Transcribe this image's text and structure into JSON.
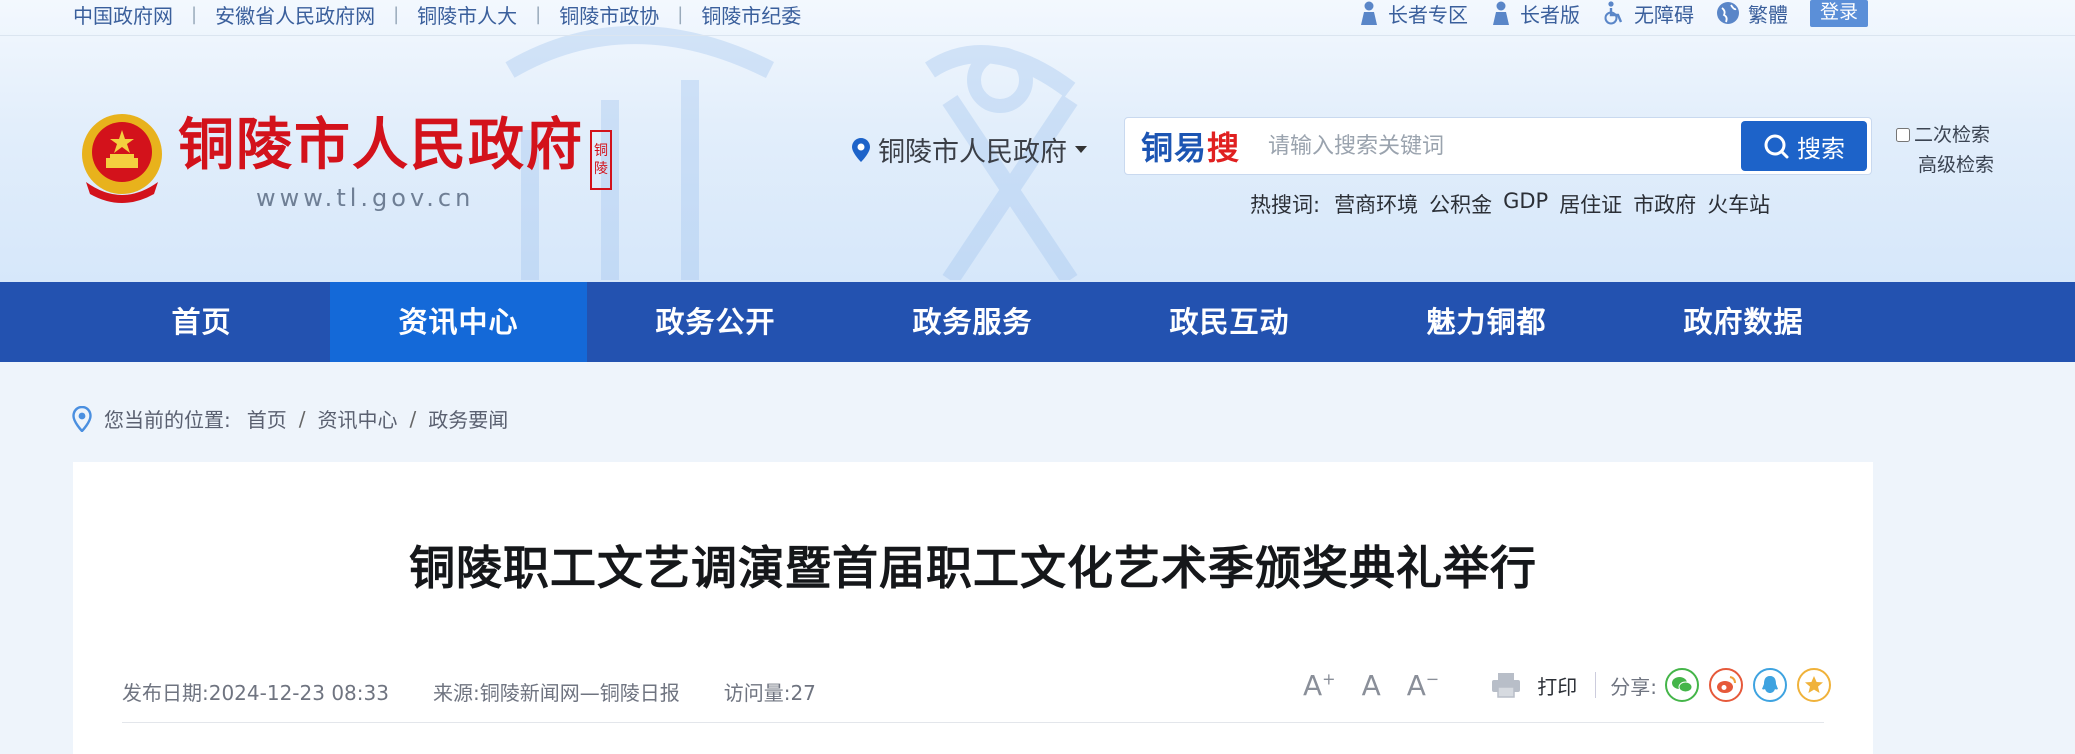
{
  "top_links": [
    "中国政府网",
    "安徽省人民政府网",
    "铜陵市人大",
    "铜陵市政协",
    "铜陵市纪委"
  ],
  "top_right": {
    "elder_zone": "长者专区",
    "elder_version": "长者版",
    "accessibility": "无障碍",
    "traditional": "繁體",
    "login": "登录"
  },
  "logo": {
    "title": "铜陵市人民政府",
    "url": "www.tl.gov.cn",
    "seal": "铜陵"
  },
  "location": "铜陵市人民政府",
  "search": {
    "brand_a": "铜易",
    "brand_b": "搜",
    "placeholder": "请输入搜索关键词",
    "button": "搜索",
    "secondary": "二次检索",
    "advanced": "高级检索"
  },
  "hot": {
    "label": "热搜词:",
    "items": [
      "营商环境",
      "公积金",
      "GDP",
      "居住证",
      "市政府",
      "火车站"
    ]
  },
  "nav": {
    "items": [
      "首页",
      "资讯中心",
      "政务公开",
      "政务服务",
      "政民互动",
      "魅力铜都",
      "政府数据"
    ],
    "active": "资讯中心"
  },
  "breadcrumb": {
    "label": "您当前的位置:",
    "items": [
      "首页",
      "资讯中心",
      "政务要闻"
    ],
    "separator": "/"
  },
  "article": {
    "title": "铜陵职工文艺调演暨首届职工文化艺术季颁奖典礼举行",
    "date": "发布日期:2024-12-23 08:33",
    "source": "来源:铜陵新闻网—铜陵日报",
    "views": "访问量:27",
    "print": "打印",
    "share": "分享:"
  },
  "colors": {
    "nav_bg": "#2352b0",
    "nav_active": "#1469d8",
    "logo_red": "#d3121b",
    "link_blue": "#3a5f9c"
  }
}
